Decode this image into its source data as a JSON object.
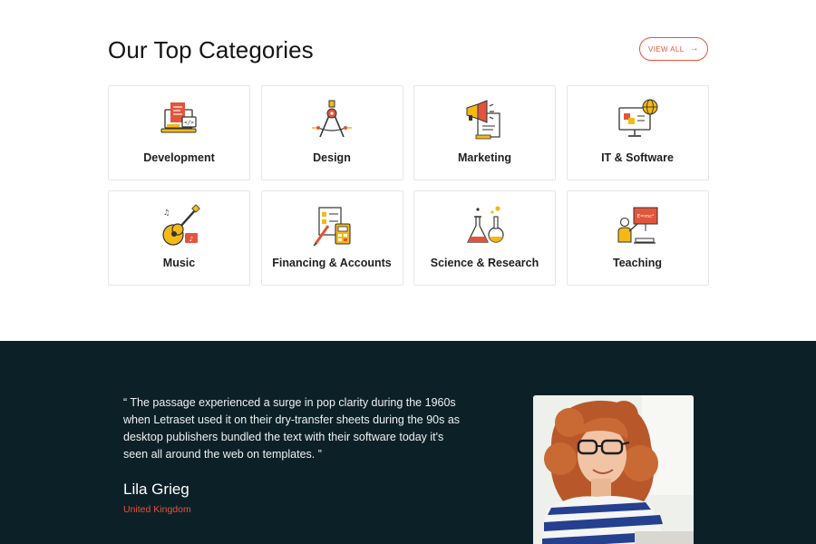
{
  "section": {
    "title": "Our Top Categories",
    "view_all_label": "VIEW ALL"
  },
  "categories": [
    {
      "label": "Development",
      "icon": "laptop-code-icon"
    },
    {
      "label": "Design",
      "icon": "compass-icon"
    },
    {
      "label": "Marketing",
      "icon": "megaphone-icon"
    },
    {
      "label": "IT & Software",
      "icon": "monitor-globe-icon"
    },
    {
      "label": "Music",
      "icon": "guitar-icon"
    },
    {
      "label": "Financing & Accounts",
      "icon": "calculator-icon"
    },
    {
      "label": "Science & Research",
      "icon": "flask-icon"
    },
    {
      "label": "Teaching",
      "icon": "teacher-board-icon"
    }
  ],
  "testimonial": {
    "quote": "“ The passage experienced a surge in pop clarity during the 1960s when Letraset used it on their dry-transfer sheets during the 90s as desktop publishers bundled the text with their software today it's seen all around the web on templates. ”",
    "author": "Lila Grieg",
    "country": "United Kingdom"
  },
  "colors": {
    "accent": "#e2553c",
    "icon_yellow": "#f5b916",
    "dark_bg": "#0c2027"
  }
}
